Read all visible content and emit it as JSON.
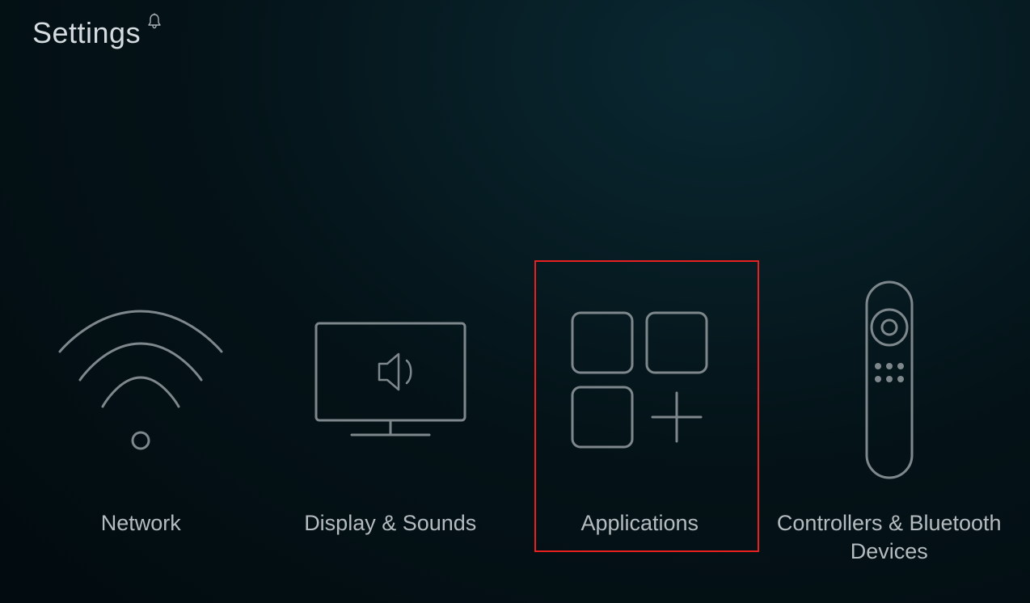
{
  "header": {
    "title": "Settings",
    "notification_icon": "bell-icon"
  },
  "tiles": [
    {
      "id": "network",
      "label": "Network",
      "icon": "wifi-icon"
    },
    {
      "id": "display-sounds",
      "label": "Display & Sounds",
      "icon": "tv-sound-icon"
    },
    {
      "id": "applications",
      "label": "Applications",
      "icon": "apps-icon",
      "highlighted": true
    },
    {
      "id": "controllers-bluetooth",
      "label": "Controllers & Bluetooth Devices",
      "icon": "remote-icon"
    }
  ],
  "colors": {
    "stroke": "#7e888c",
    "highlight": "#e82020",
    "text": "#b5bcc0"
  }
}
